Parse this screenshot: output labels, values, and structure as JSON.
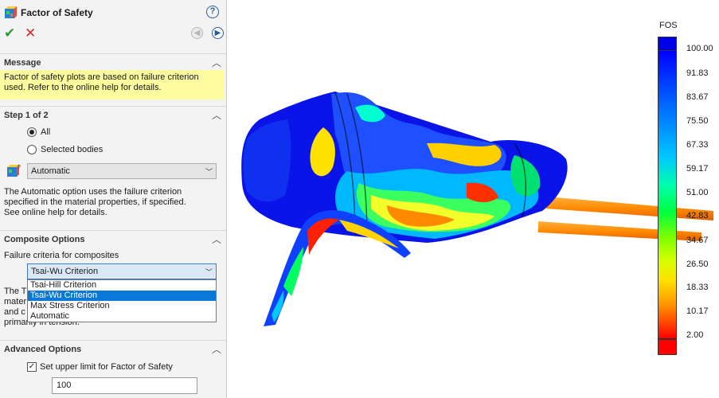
{
  "window": {
    "title": "Factor of Safety"
  },
  "sections": {
    "message": {
      "header": "Message",
      "text_line1": "Factor of safety plots are based on failure criterion",
      "text_line2": "used. Refer to the online help for details."
    },
    "step": {
      "header": "Step 1 of 2",
      "radio_all": "All",
      "radio_selected": "Selected bodies",
      "selected_radio": "All",
      "criterion_value": "Automatic",
      "desc_line1": "The Automatic option uses the failure criterion",
      "desc_line2": "specified in the material properties, if specified.",
      "desc_line3": "See online help for details."
    },
    "composite": {
      "header": "Composite Options",
      "label": "Failure criteria for composites",
      "selected_value": "Tsai-Wu Criterion",
      "options": [
        "Tsai-Hill Criterion",
        "Tsai-Wu Criterion",
        "Max Stress Criterion",
        "Automatic"
      ],
      "partial_line1": "The T",
      "partial_line2": "mater",
      "partial_line3": "and c",
      "partial_line4": "primarily in tension."
    },
    "advanced": {
      "header": "Advanced Options",
      "checkbox_label": "Set upper limit for Factor of Safety",
      "checkbox_checked": true,
      "upper_limit_value": "100"
    }
  },
  "legend": {
    "title": "FOS",
    "labels": [
      "100.00",
      "91.83",
      "83.67",
      "75.50",
      "67.33",
      "59.17",
      "51.00",
      "42.83",
      "34.67",
      "26.50",
      "18.33",
      "10.17",
      "2.00"
    ],
    "top_color": "#0000e6",
    "bottom_color": "#ff0000"
  },
  "colors": {
    "accent": "#0a78d7",
    "message_bg": "#fdfda0",
    "ok": "#2e9a33",
    "cancel": "#d42a2a"
  }
}
